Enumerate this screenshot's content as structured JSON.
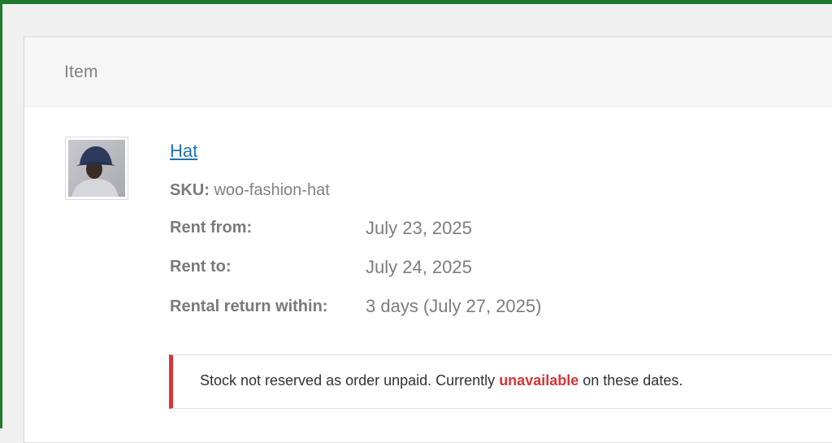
{
  "table": {
    "header_label": "Item"
  },
  "item": {
    "name": "Hat",
    "sku_label": "SKU:",
    "sku_value": "woo-fashion-hat",
    "thumbnail_icon": "product-thumbnail-image",
    "meta": [
      {
        "label": "Rent from:",
        "value": "July 23, 2025"
      },
      {
        "label": "Rent to:",
        "value": "July 24, 2025"
      },
      {
        "label": "Rental return within:",
        "value": "3 days (July 27, 2025)"
      }
    ]
  },
  "notice": {
    "text_before": "Stock not reserved as order unpaid. Currently ",
    "highlight": "unavailable",
    "text_after": " on these dates."
  },
  "colors": {
    "accent_green": "#1f7a2e",
    "link_blue": "#2271b1",
    "error_red": "#d63638"
  }
}
